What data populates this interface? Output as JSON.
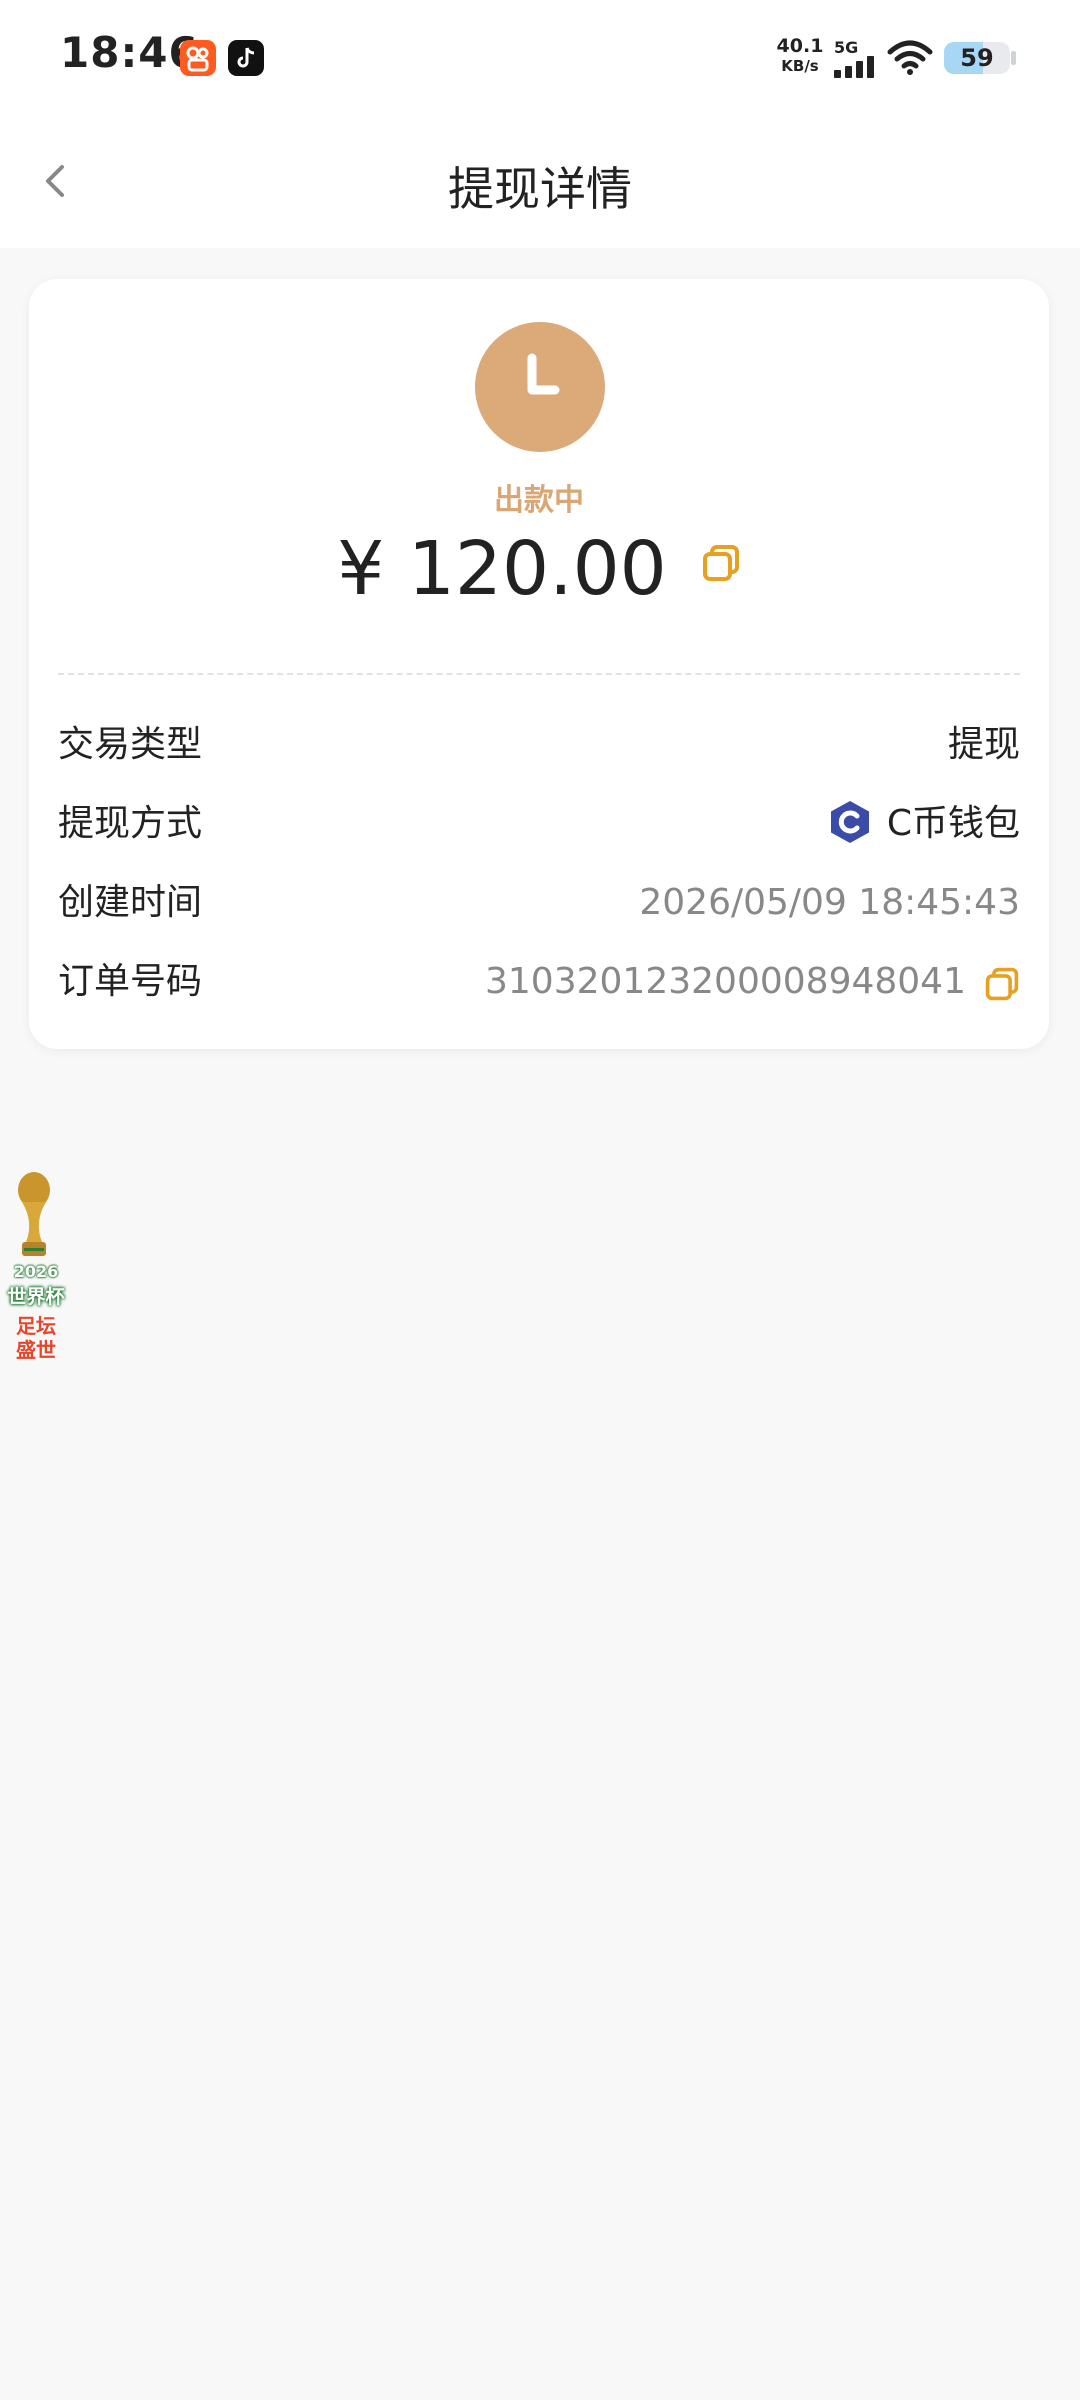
{
  "status_bar": {
    "time": "18:46",
    "net_speed_value": "40.1",
    "net_speed_unit": "KB/s",
    "network": "5G",
    "battery": "59",
    "battery_level": 0.59,
    "app_icons": [
      "kuaishou-icon",
      "douyin-icon"
    ]
  },
  "nav": {
    "back_icon": "chevron-left-icon",
    "title": "提现详情"
  },
  "summary": {
    "status_icon": "clock-icon",
    "status_text": "出款中",
    "amount": "¥ 120.00",
    "copy_icon": "copy-icon"
  },
  "details": [
    {
      "label": "交易类型",
      "value": "提现"
    },
    {
      "label": "提现方式",
      "value": "C币钱包",
      "icon": "c-wallet-icon"
    },
    {
      "label": "创建时间",
      "value": "2026/05/09 18:45:43"
    },
    {
      "label": "订单号码",
      "value": "310320123200008948041",
      "icon": "copy-icon"
    }
  ],
  "float_badge": {
    "year": "2026",
    "title": "世界杯",
    "slogan_line1": "足坛",
    "slogan_line2": "盛世"
  },
  "colors": {
    "accent": "#dcaa78",
    "status_text": "#d8a775",
    "copy_icon": "#e8a020",
    "wallet_icon": "#3b4ca8",
    "page_bg": "#f8f8f8"
  }
}
